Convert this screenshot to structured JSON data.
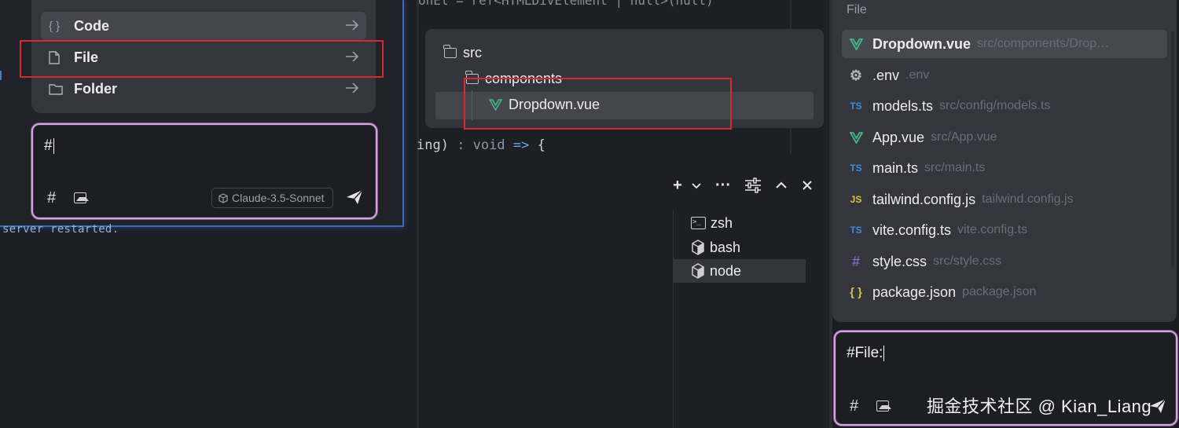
{
  "left": {
    "menu": [
      {
        "icon": "braces-icon",
        "icon_text": "{ }",
        "label": "Code"
      },
      {
        "icon": "file-icon",
        "label": "File"
      },
      {
        "icon": "folder-icon",
        "label": "Folder"
      }
    ],
    "chat": {
      "value": "#",
      "model": "Claude-3.5-Sonnet"
    },
    "terminal_output": "server restarted."
  },
  "middle": {
    "code_top": "onEl = ref<HTMLDivElement | null>(null)",
    "code_line": {
      "a": "ing)",
      "b": " : void ",
      "c": "=>",
      "d": " {"
    },
    "tree": {
      "root": "src",
      "folder": "components",
      "file": "Dropdown.vue"
    },
    "terminals": [
      {
        "name": "zsh",
        "icon": "terminal-icon"
      },
      {
        "name": "bash",
        "icon": "cube-icon"
      },
      {
        "name": "node",
        "icon": "cube-icon",
        "selected": true
      }
    ]
  },
  "right": {
    "header": "File",
    "files": [
      {
        "icon": "vue-icon",
        "name": "Dropdown.vue",
        "path": "src/components/Drop…",
        "selected": true
      },
      {
        "icon": "gear-icon",
        "name": ".env",
        "path": ".env"
      },
      {
        "icon": "ts-icon",
        "icon_text": "TS",
        "name": "models.ts",
        "path": "src/config/models.ts"
      },
      {
        "icon": "vue-icon",
        "name": "App.vue",
        "path": "src/App.vue"
      },
      {
        "icon": "ts-icon",
        "icon_text": "TS",
        "name": "main.ts",
        "path": "src/main.ts"
      },
      {
        "icon": "js-icon",
        "icon_text": "JS",
        "name": "tailwind.config.js",
        "path": "tailwind.config.js"
      },
      {
        "icon": "ts-icon",
        "icon_text": "TS",
        "name": "vite.config.ts",
        "path": "vite.config.ts"
      },
      {
        "icon": "css-icon",
        "icon_text": "#",
        "name": "style.css",
        "path": "src/style.css"
      },
      {
        "icon": "json-icon",
        "icon_text": "{ }",
        "name": "package.json",
        "path": "package.json"
      }
    ],
    "chat": {
      "value": "#File:"
    }
  },
  "watermark": "掘金技术社区 @ Kian_Liang",
  "colors": {
    "highlight_red": "#d9282f",
    "vue_green": "#41b883",
    "ts_blue": "#3b8fd8",
    "js_yellow": "#d8c23b",
    "terminal_blue": "#3b68b8"
  }
}
